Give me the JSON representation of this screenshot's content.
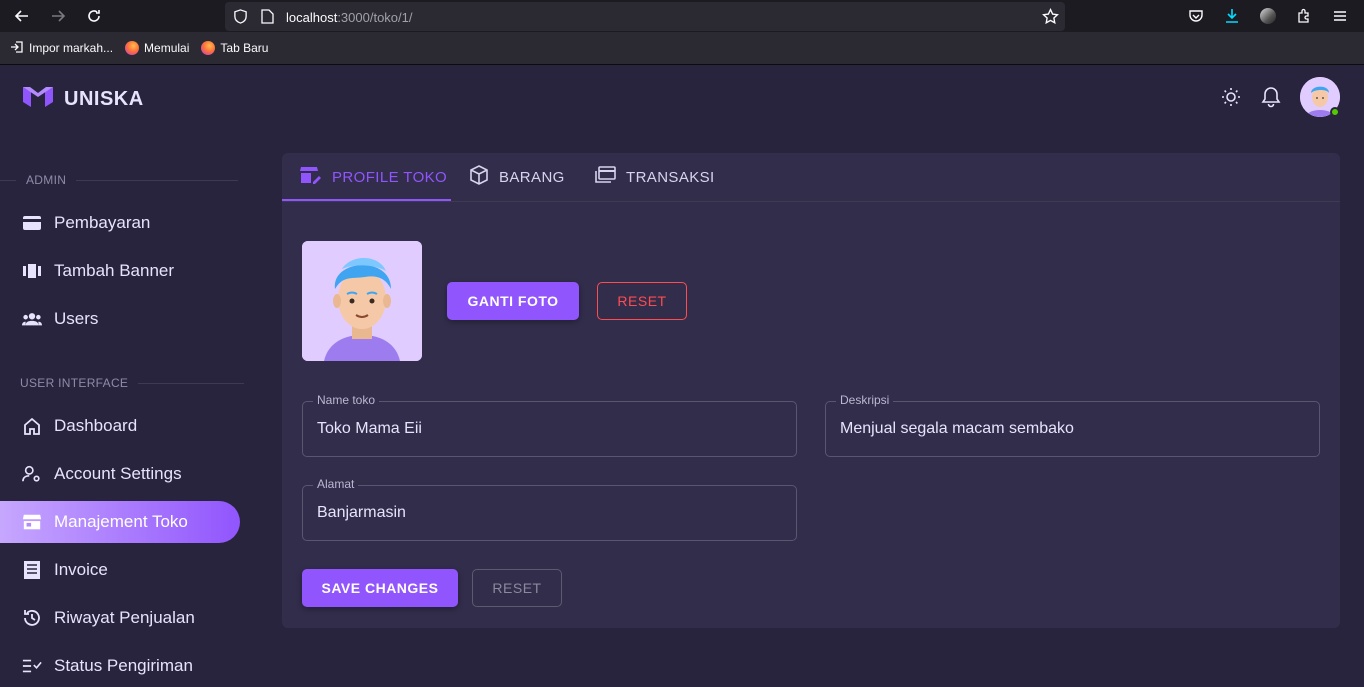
{
  "browser": {
    "url_host": "localhost",
    "url_path": ":3000/toko/1/",
    "bookmarks": [
      {
        "label": "Impor markah..."
      },
      {
        "label": "Memulai"
      },
      {
        "label": "Tab Baru"
      }
    ]
  },
  "app": {
    "brand": "UNISKA"
  },
  "sidebar": {
    "section_admin": "ADMIN",
    "section_ui": "USER INTERFACE",
    "admin_items": [
      {
        "label": "Pembayaran",
        "icon": "credit-card-icon"
      },
      {
        "label": "Tambah Banner",
        "icon": "view-carousel-icon"
      },
      {
        "label": "Users",
        "icon": "account-group-icon"
      }
    ],
    "ui_items": [
      {
        "label": "Dashboard",
        "icon": "home-icon"
      },
      {
        "label": "Account Settings",
        "icon": "account-cog-icon"
      },
      {
        "label": "Manajement Toko",
        "icon": "storefront-icon",
        "active": true
      },
      {
        "label": "Invoice",
        "icon": "receipt-icon"
      },
      {
        "label": "Riwayat Penjualan",
        "icon": "history-icon"
      },
      {
        "label": "Status Pengiriman",
        "icon": "checklist-icon"
      }
    ]
  },
  "tabs": [
    {
      "label": "PROFILE TOKO",
      "icon": "store-edit-icon",
      "active": true
    },
    {
      "label": "BARANG",
      "icon": "cube-icon"
    },
    {
      "label": "TRANSAKSI",
      "icon": "cards-icon"
    }
  ],
  "photo_section": {
    "change_photo": "GANTI FOTO",
    "reset": "RESET"
  },
  "form": {
    "name_label": "Name toko",
    "name_value": "Toko Mama Eii",
    "desc_label": "Deskripsi",
    "desc_value": "Menjual segala macam sembako",
    "address_label": "Alamat",
    "address_value": "Banjarmasin",
    "save": "SAVE CHANGES",
    "reset": "RESET"
  },
  "colors": {
    "primary": "#9155fd",
    "background": "#28243d",
    "card": "#312d4b",
    "error": "#ff4c51",
    "online": "#56ca00"
  }
}
